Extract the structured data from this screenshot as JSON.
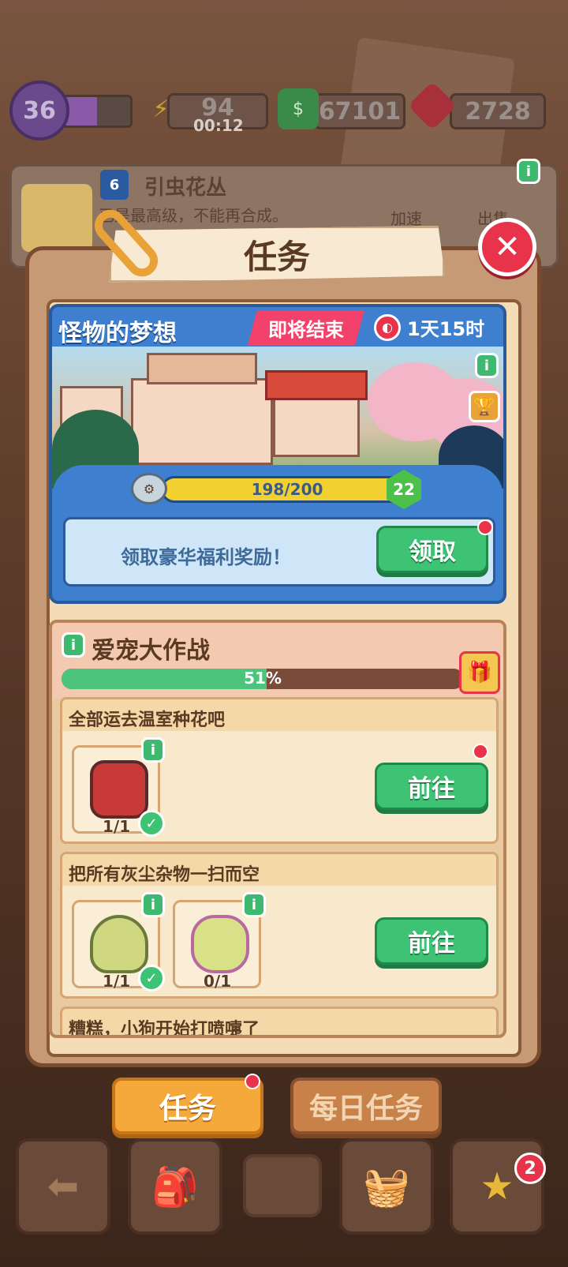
{
  "top_bar": {
    "level": "36",
    "xp_fraction": 0.5,
    "energy": "94",
    "energy_timer": "00:12",
    "cash": "67101",
    "gems": "2728",
    "icons": {
      "energy": "lightning-icon",
      "cash": "cash-stack-icon",
      "gems": "ruby-icon"
    }
  },
  "background_item": {
    "level": "6",
    "name": "引虫花丛",
    "desc": "已是最高级，不能再合成。",
    "speed_label": "加速",
    "sell_label": "出售"
  },
  "modal": {
    "title": "任务"
  },
  "event": {
    "title": "怪物的梦想",
    "tag": "即将结束",
    "timer": "1天15时",
    "progress_text": "198/200",
    "progress_value": 198,
    "progress_max": 200,
    "reward_level": "22",
    "claim_text": "领取豪华福利奖励！",
    "claim_button": "领取"
  },
  "task_group": {
    "title": "爱宠大作战",
    "progress_percent": 51,
    "progress_text": "51%",
    "tasks": [
      {
        "title": "全部运去温室种花吧",
        "items": [
          {
            "icon": "red-wagon-icon",
            "count": "1/1",
            "done": true
          }
        ],
        "button": "前往"
      },
      {
        "title": "把所有灰尘杂物一扫而空",
        "items": [
          {
            "icon": "broom-icon",
            "count": "1/1",
            "done": true
          },
          {
            "icon": "cleaner-bottle-icon",
            "count": "0/1",
            "done": false
          }
        ],
        "button": "前往"
      },
      {
        "title": "糟糕，小狗开始打喷嚏了"
      }
    ]
  },
  "tabs": {
    "tasks": "任务",
    "daily": "每日任务"
  },
  "nav": {
    "star_badge": "2"
  },
  "colors": {
    "accent_green": "#3ec274",
    "accent_orange": "#f5a93a",
    "event_blue": "#3e80cf",
    "alert_red": "#e8334a"
  }
}
